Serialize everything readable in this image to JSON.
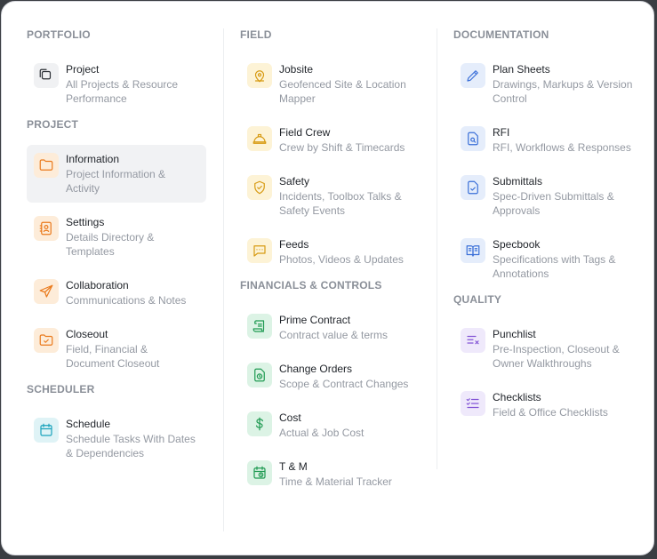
{
  "columns": [
    {
      "sections": [
        {
          "title": "PORTFOLIO",
          "items": [
            {
              "title": "Project",
              "desc": "All Projects & Resource Performance",
              "icon": "folders-icon",
              "color": "gray"
            }
          ]
        },
        {
          "title": "PROJECT",
          "items": [
            {
              "title": "Information",
              "desc": "Project Information & Activity",
              "icon": "folder-icon",
              "color": "orange",
              "active": true
            },
            {
              "title": "Settings",
              "desc": "Details Directory & Templates",
              "icon": "contact-book-icon",
              "color": "orange"
            },
            {
              "title": "Collaboration",
              "desc": "Communications & Notes",
              "icon": "send-icon",
              "color": "orange"
            },
            {
              "title": "Closeout",
              "desc": "Field, Financial & Document Closeout",
              "icon": "folder-check-icon",
              "color": "orange"
            }
          ]
        },
        {
          "title": "SCHEDULER",
          "items": [
            {
              "title": "Schedule",
              "desc": "Schedule Tasks With Dates & Dependencies",
              "icon": "calendar-icon",
              "color": "teal"
            }
          ]
        }
      ]
    },
    {
      "sections": [
        {
          "title": "FIELD",
          "items": [
            {
              "title": "Jobsite",
              "desc": "Geofenced Site & Location Mapper",
              "icon": "location-pin-icon",
              "color": "yellow"
            },
            {
              "title": "Field Crew",
              "desc": "Crew by Shift & Timecards",
              "icon": "hard-hat-icon",
              "color": "yellow"
            },
            {
              "title": "Safety",
              "desc": "Incidents, Toolbox Talks & Safety Events",
              "icon": "shield-check-icon",
              "color": "yellow"
            },
            {
              "title": "Feeds",
              "desc": "Photos, Videos & Updates",
              "icon": "chat-bubble-icon",
              "color": "yellow"
            }
          ]
        },
        {
          "title": "FINANCIALS & CONTROLS",
          "items": [
            {
              "title": "Prime Contract",
              "desc": "Contract value & terms",
              "icon": "scroll-icon",
              "color": "green"
            },
            {
              "title": "Change Orders",
              "desc": "Scope & Contract Changes",
              "icon": "file-clock-icon",
              "color": "green"
            },
            {
              "title": "Cost",
              "desc": "Actual & Job Cost",
              "icon": "dollar-icon",
              "color": "green"
            },
            {
              "title": "T & M",
              "desc": "Time & Material Tracker",
              "icon": "calendar-clock-icon",
              "color": "green"
            }
          ]
        }
      ]
    },
    {
      "sections": [
        {
          "title": "DOCUMENTATION",
          "items": [
            {
              "title": "Plan Sheets",
              "desc": "Drawings, Markups & Version Control",
              "icon": "pencil-icon",
              "color": "blue"
            },
            {
              "title": "RFI",
              "desc": "RFI, Workflows & Responses",
              "icon": "file-search-icon",
              "color": "blue"
            },
            {
              "title": "Submittals",
              "desc": "Spec-Driven Submittals & Approvals",
              "icon": "file-check-icon",
              "color": "blue"
            },
            {
              "title": "Specbook",
              "desc": "Specifications with Tags & Annotations",
              "icon": "open-book-icon",
              "color": "blue"
            }
          ]
        },
        {
          "title": "QUALITY",
          "items": [
            {
              "title": "Punchlist",
              "desc": "Pre-Inspection, Closeout & Owner Walkthroughs",
              "icon": "list-x-icon",
              "color": "purple"
            },
            {
              "title": "Checklists",
              "desc": "Field & Office Checklists",
              "icon": "checklist-icon",
              "color": "purple"
            }
          ]
        }
      ]
    }
  ]
}
